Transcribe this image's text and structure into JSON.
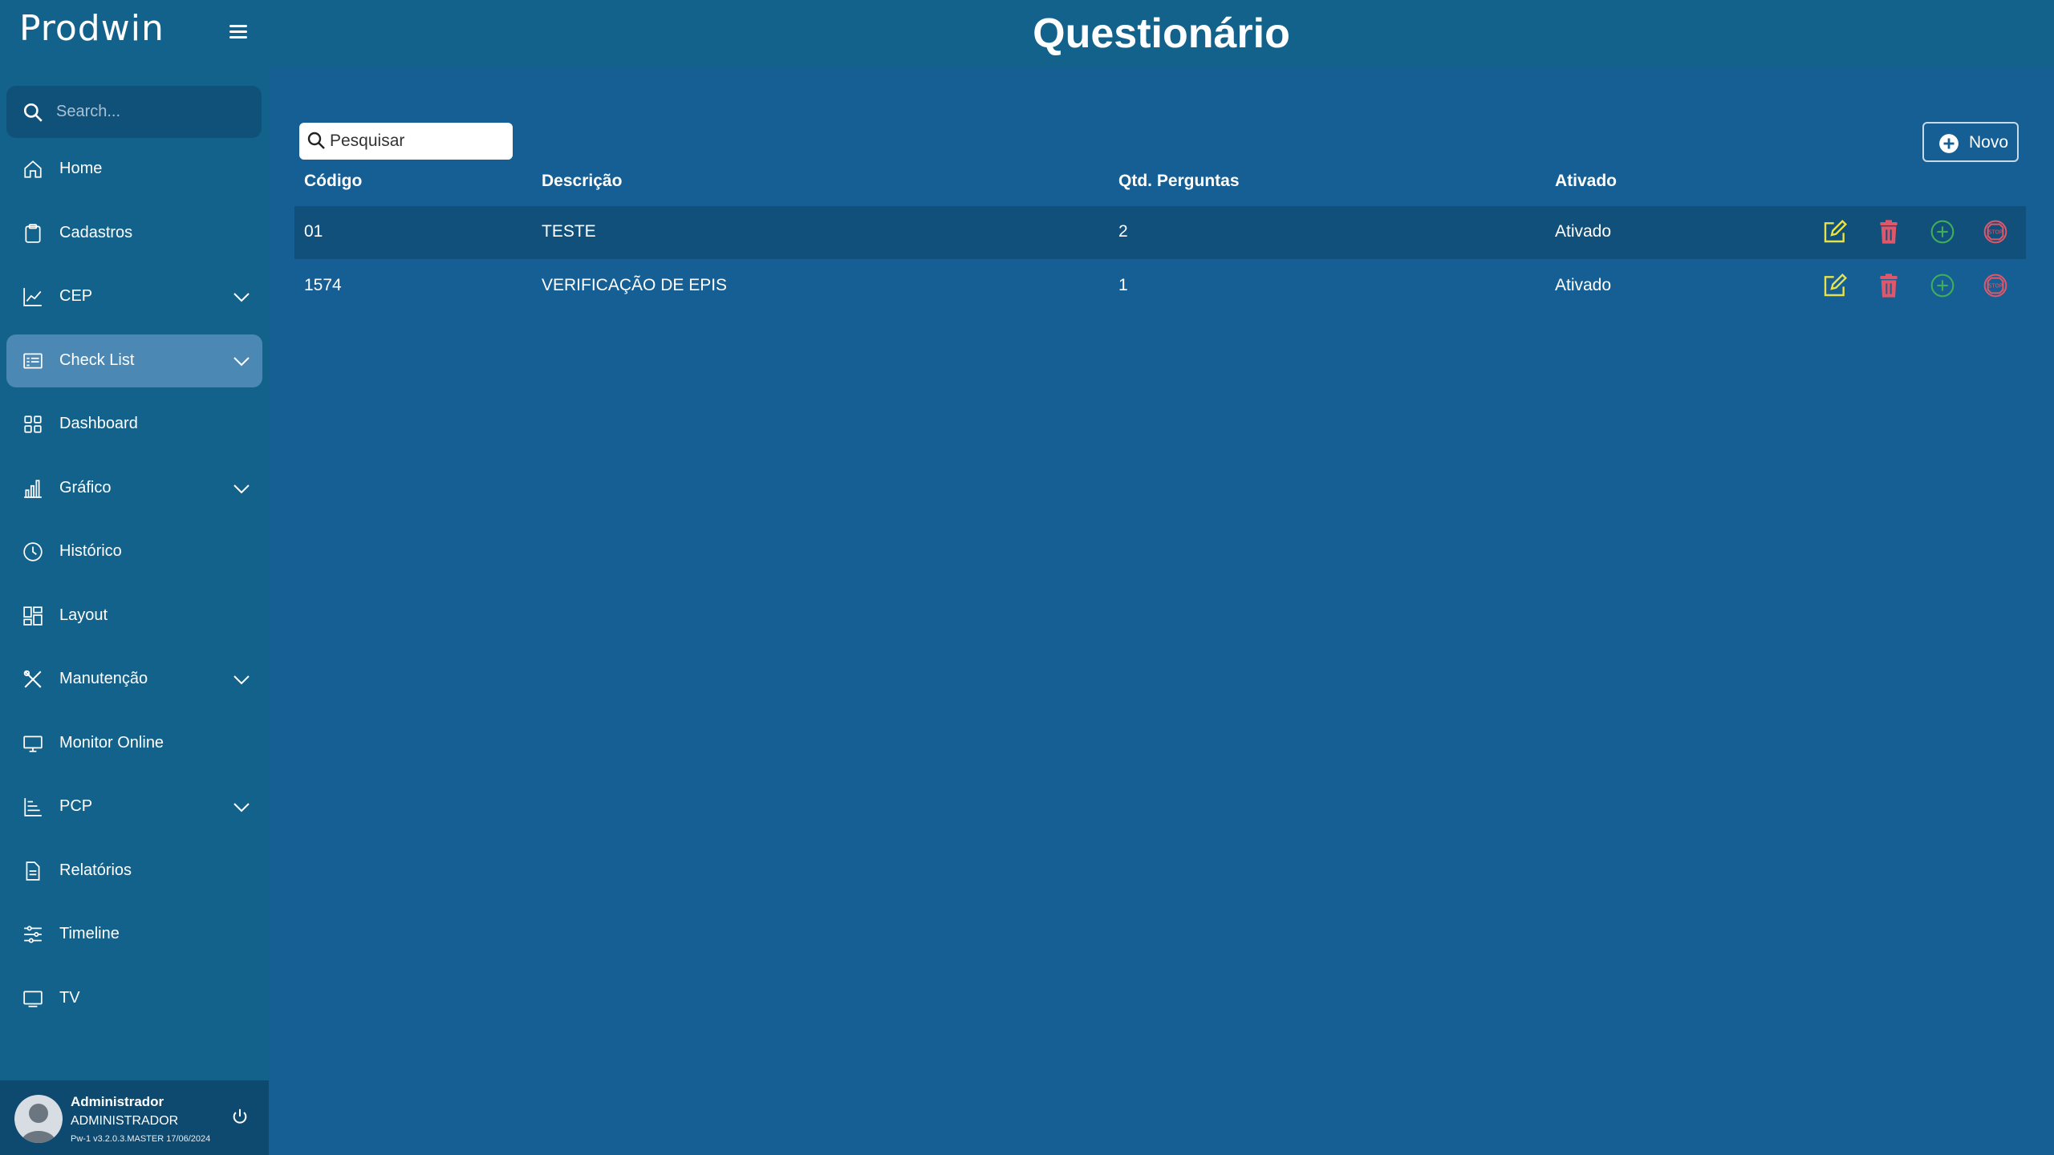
{
  "brand": {
    "logo_text": "Prodwin"
  },
  "sidebar": {
    "search_placeholder": "Search...",
    "items": [
      {
        "label": "Home",
        "icon": "home-icon",
        "expandable": false,
        "active": false
      },
      {
        "label": "Cadastros",
        "icon": "clipboard-icon",
        "expandable": false,
        "active": false
      },
      {
        "label": "CEP",
        "icon": "line-chart-icon",
        "expandable": true,
        "active": false
      },
      {
        "label": "Check List",
        "icon": "checklist-icon",
        "expandable": true,
        "active": true
      },
      {
        "label": "Dashboard",
        "icon": "grid-icon",
        "expandable": false,
        "active": false
      },
      {
        "label": "Gráfico",
        "icon": "bar-chart-icon",
        "expandable": true,
        "active": false
      },
      {
        "label": "Histórico",
        "icon": "clock-icon",
        "expandable": false,
        "active": false
      },
      {
        "label": "Layout",
        "icon": "layout-icon",
        "expandable": false,
        "active": false
      },
      {
        "label": "Manutenção",
        "icon": "tools-icon",
        "expandable": true,
        "active": false
      },
      {
        "label": "Monitor Online",
        "icon": "monitor-icon",
        "expandable": false,
        "active": false
      },
      {
        "label": "PCP",
        "icon": "pcp-icon",
        "expandable": true,
        "active": false
      },
      {
        "label": "Relatórios",
        "icon": "document-icon",
        "expandable": false,
        "active": false
      },
      {
        "label": "Timeline",
        "icon": "sliders-icon",
        "expandable": false,
        "active": false
      },
      {
        "label": "TV",
        "icon": "tv-icon",
        "expandable": false,
        "active": false
      }
    ]
  },
  "user": {
    "name": "Administrador",
    "role": "ADMINISTRADOR",
    "version": "Pw-1 v3.2.0.3.MASTER 17/06/2024"
  },
  "header": {
    "title": "Questionário"
  },
  "toolbar": {
    "search_placeholder": "Pesquisar",
    "new_label": "Novo"
  },
  "table": {
    "columns": [
      "Código",
      "Descrição",
      "Qtd. Perguntas",
      "Ativado"
    ],
    "rows": [
      {
        "codigo": "01",
        "descricao": "TESTE",
        "qtd": "2",
        "ativado": "Ativado"
      },
      {
        "codigo": "1574",
        "descricao": "VERIFICAÇÃO DE EPIS",
        "qtd": "1",
        "ativado": "Ativado"
      }
    ],
    "actions": [
      "edit-icon",
      "trash-icon",
      "add-circle-icon",
      "stop-icon"
    ]
  },
  "colors": {
    "background": "#165f94",
    "sidebar": "#13628c",
    "active_item": "#4b89b4",
    "edit": "#e8e24a",
    "delete": "#e0576a",
    "add": "#3fae5a",
    "stop": "#e0576a"
  }
}
